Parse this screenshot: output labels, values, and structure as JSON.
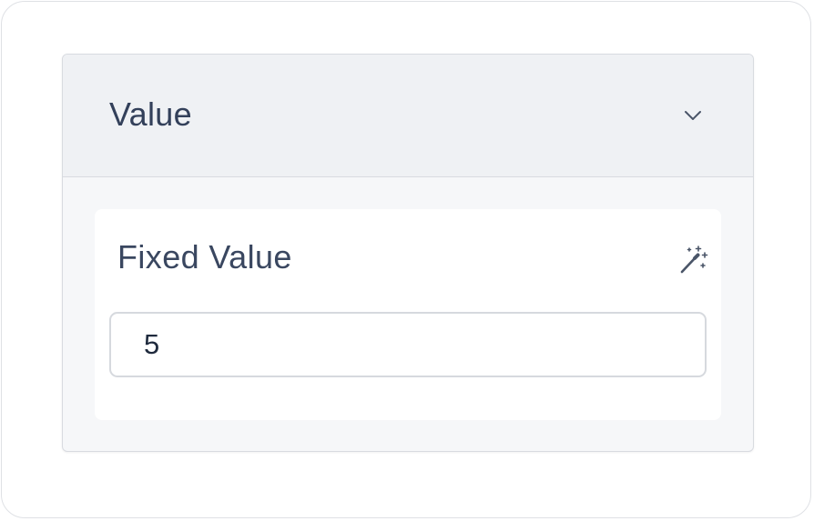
{
  "panel": {
    "title": "Value",
    "expanded": true,
    "toggle_icon": "chevron-down-icon"
  },
  "field": {
    "label": "Fixed Value",
    "action_icon": "magic-wand-icon",
    "value": "5"
  },
  "colors": {
    "header_bg": "#eff1f4",
    "body_bg": "#f6f7f9",
    "text": "#33405a",
    "border": "#d8dbe0"
  }
}
